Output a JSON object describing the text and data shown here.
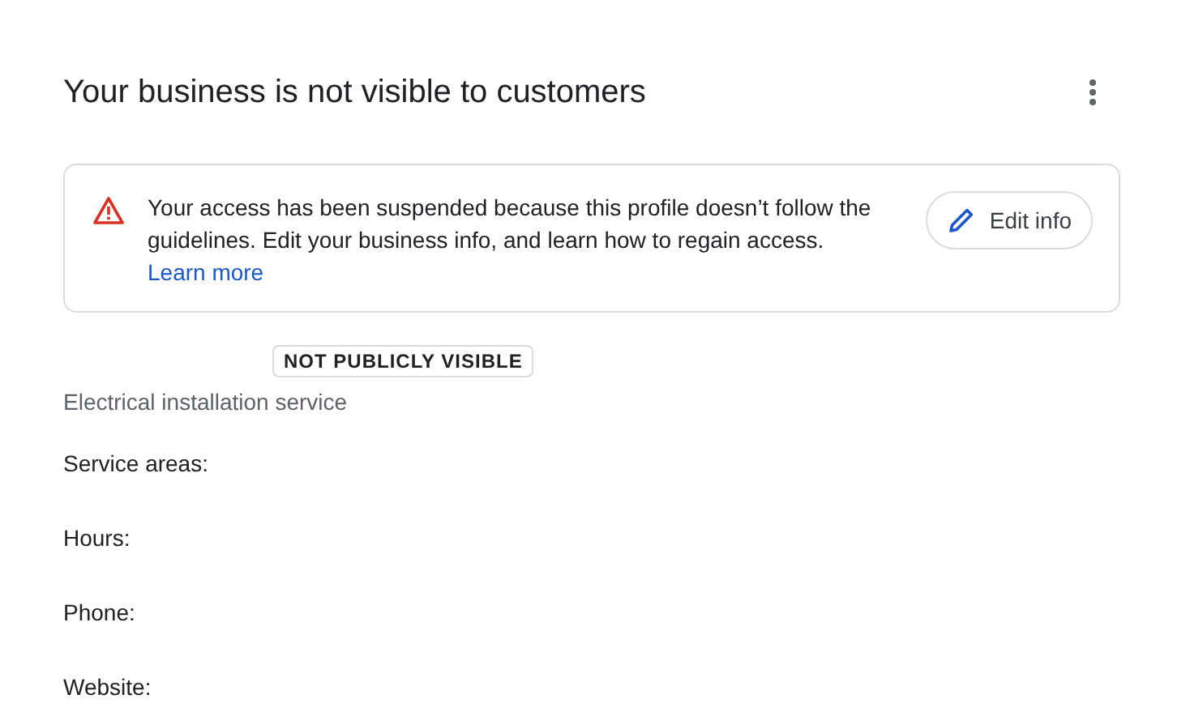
{
  "header": {
    "title": "Your business is not visible to customers"
  },
  "alert": {
    "message": "Your access has been suspended because this profile doesn’t follow the guidelines. Edit your business info, and learn how to regain access.",
    "link": "Learn more",
    "button": "Edit info"
  },
  "badge": "NOT PUBLICLY VISIBLE",
  "category": "Electrical installation service",
  "details": [
    {
      "label": "Service areas:"
    },
    {
      "label": "Hours:"
    },
    {
      "label": "Phone:"
    },
    {
      "label": "Website:"
    }
  ]
}
